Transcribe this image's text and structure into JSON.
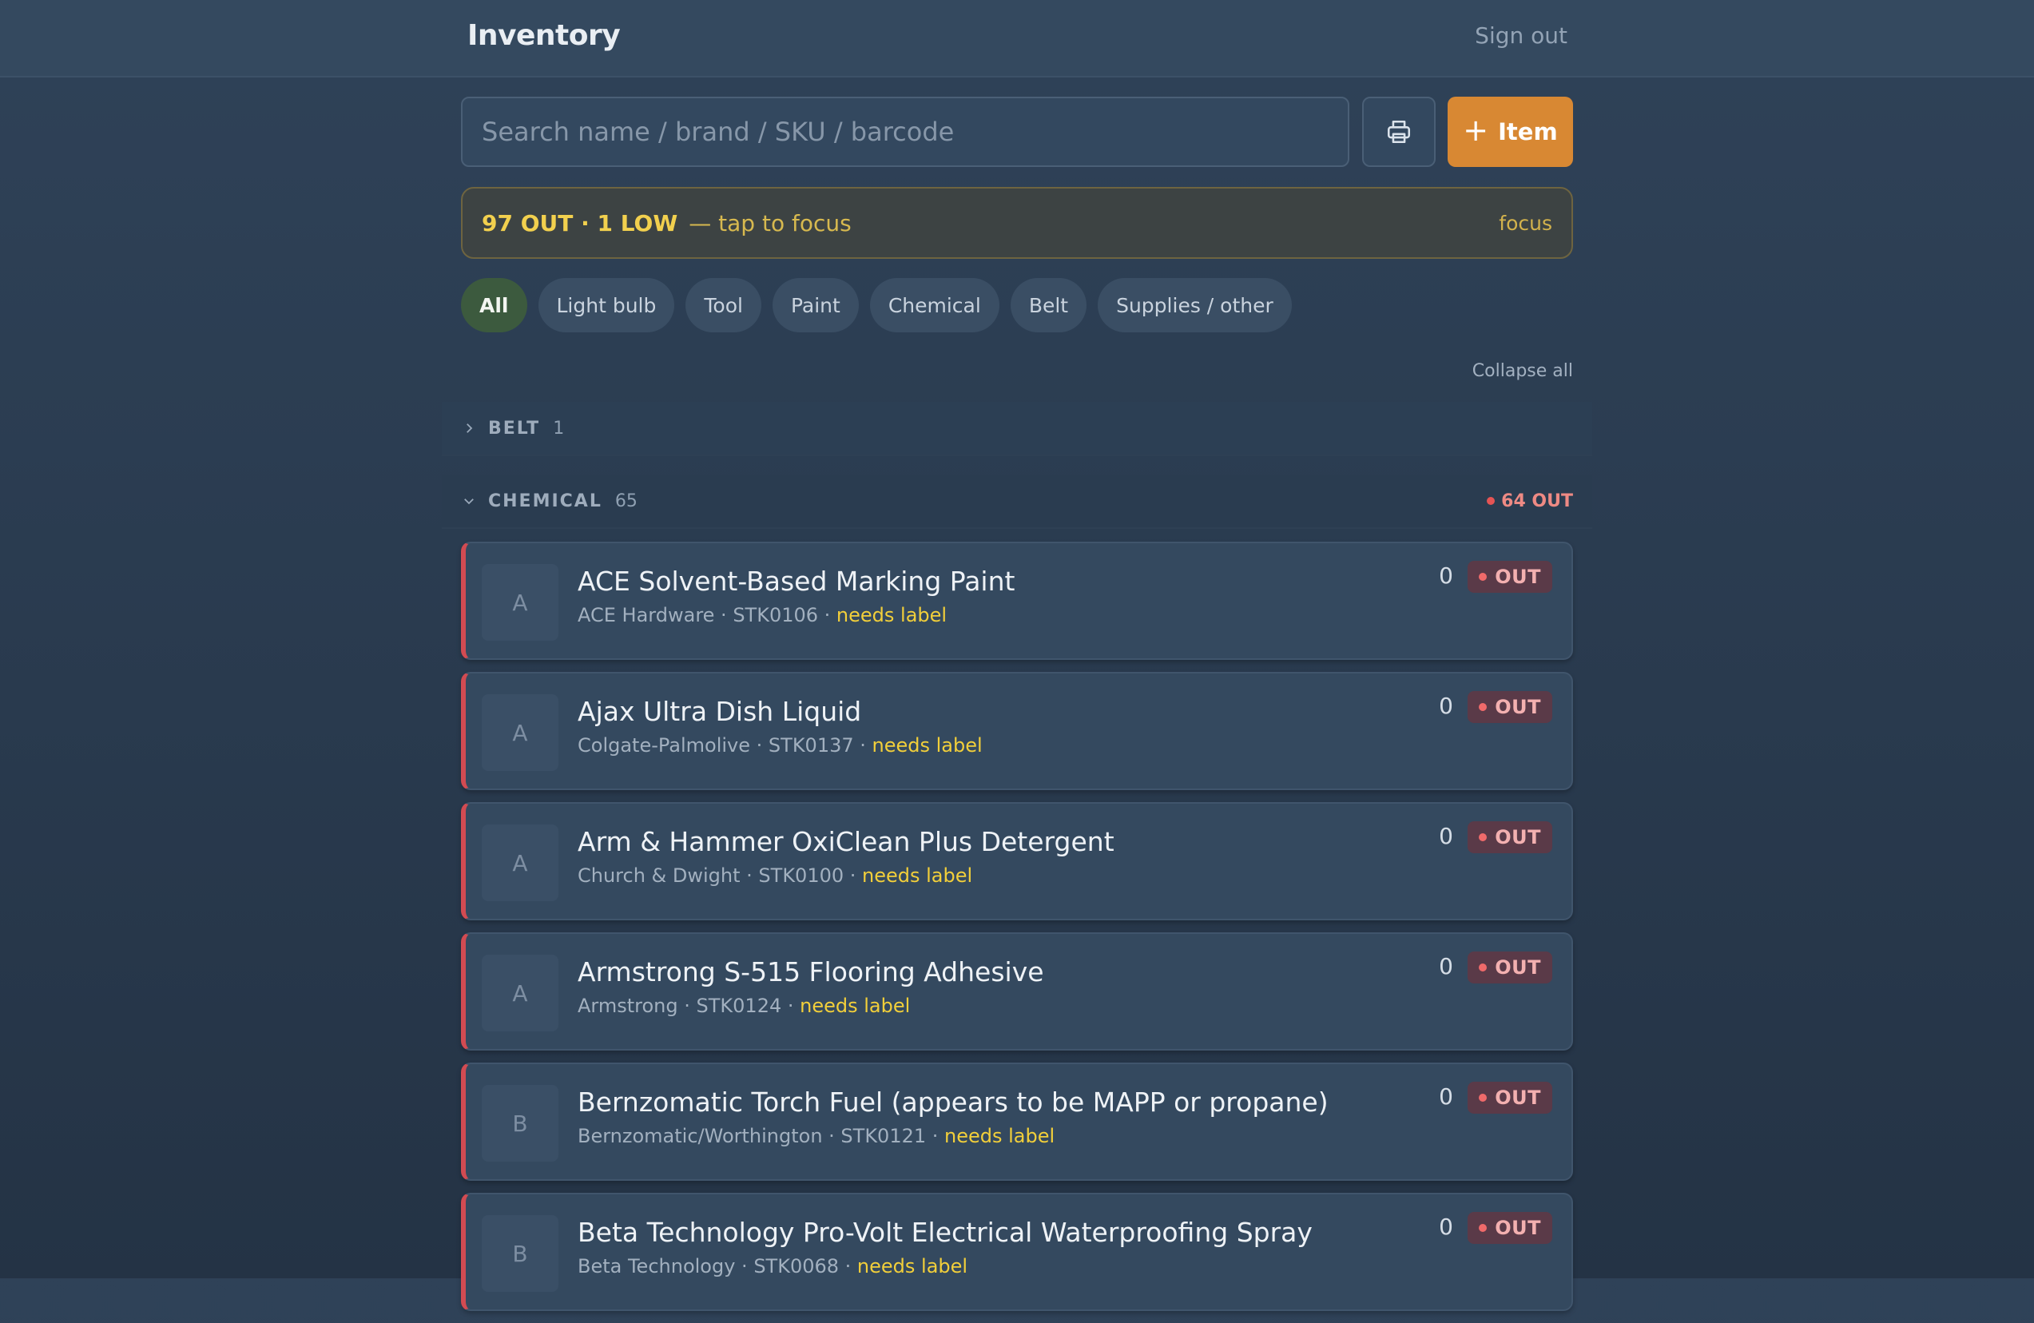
{
  "header": {
    "title": "Inventory",
    "sign_out": "Sign out"
  },
  "toolbar": {
    "search_placeholder": "Search name / brand / SKU / barcode",
    "print_icon": "printer-icon",
    "add_item_label": "Item"
  },
  "alert": {
    "counts": "97 OUT · 1 LOW",
    "hint": "— tap to focus",
    "focus_label": "focus"
  },
  "filters": [
    {
      "label": "All",
      "active": true
    },
    {
      "label": "Light bulb"
    },
    {
      "label": "Tool"
    },
    {
      "label": "Paint"
    },
    {
      "label": "Chemical"
    },
    {
      "label": "Belt"
    },
    {
      "label": "Supplies / other"
    }
  ],
  "collapse_all": "Collapse all",
  "groups": [
    {
      "name": "BELT",
      "count": "1",
      "expanded": false
    },
    {
      "name": "CHEMICAL",
      "count": "65",
      "expanded": true,
      "out_label": "64 OUT"
    }
  ],
  "items": [
    {
      "initial": "A",
      "name": "ACE Solvent-Based Marking Paint",
      "brand": "ACE Hardware",
      "sku": "STK0106",
      "flag": "needs label",
      "qty": "0",
      "status": "OUT"
    },
    {
      "initial": "A",
      "name": "Ajax Ultra Dish Liquid",
      "brand": "Colgate-Palmolive",
      "sku": "STK0137",
      "flag": "needs label",
      "qty": "0",
      "status": "OUT"
    },
    {
      "initial": "A",
      "name": "Arm & Hammer OxiClean Plus Detergent",
      "brand": "Church & Dwight",
      "sku": "STK0100",
      "flag": "needs label",
      "qty": "0",
      "status": "OUT"
    },
    {
      "initial": "A",
      "name": "Armstrong S-515 Flooring Adhesive",
      "brand": "Armstrong",
      "sku": "STK0124",
      "flag": "needs label",
      "qty": "0",
      "status": "OUT"
    },
    {
      "initial": "B",
      "name": "Bernzomatic Torch Fuel (appears to be MAPP or propane)",
      "brand": "Bernzomatic/Worthington",
      "sku": "STK0121",
      "flag": "needs label",
      "qty": "0",
      "status": "OUT"
    },
    {
      "initial": "B",
      "name": "Beta Technology Pro-Volt Electrical Waterproofing Spray",
      "brand": "Beta Technology",
      "sku": "STK0068",
      "flag": "needs label",
      "qty": "0",
      "status": "OUT"
    }
  ],
  "colors": {
    "accent": "#d88833",
    "out": "#d24b52",
    "warning": "#f2cf3a",
    "active_chip": "#3c5a3e"
  }
}
